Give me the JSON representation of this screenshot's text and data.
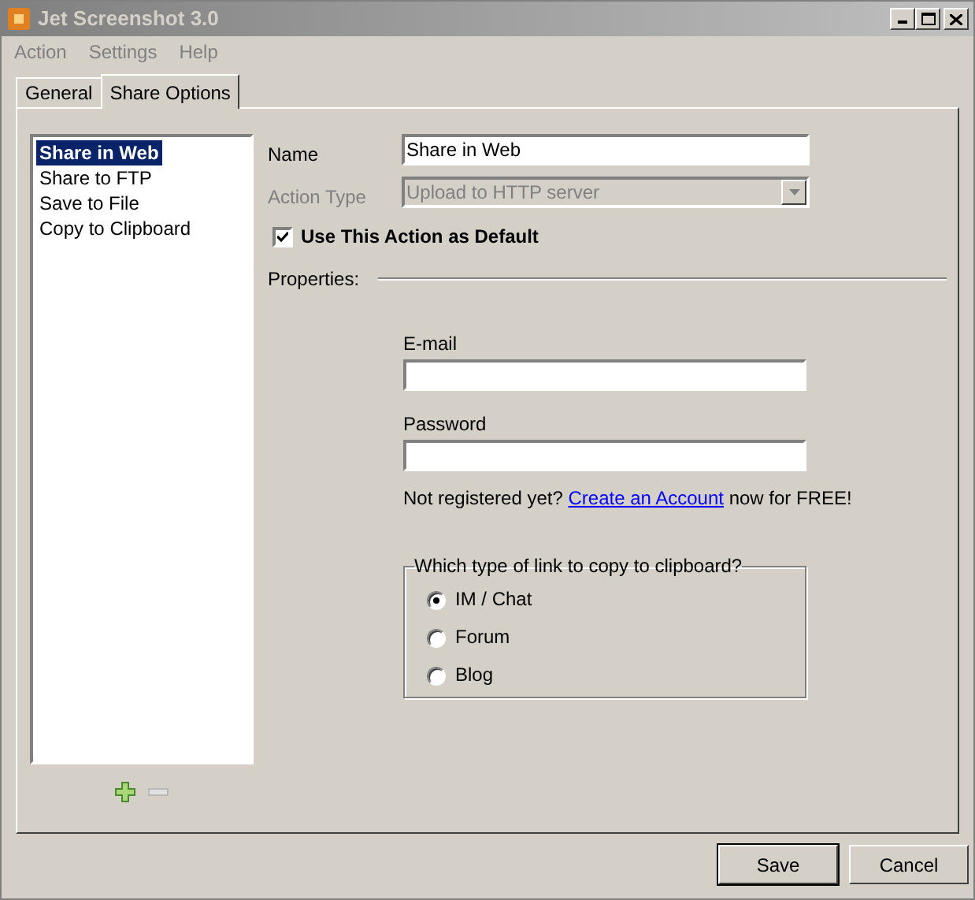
{
  "window": {
    "title": "Jet Screenshot 3.0"
  },
  "menu": [
    "Action",
    "Settings",
    "Help"
  ],
  "tabs": [
    {
      "label": "General",
      "selected": false
    },
    {
      "label": "Share Options",
      "selected": true
    }
  ],
  "actions": [
    {
      "label": "Share in Web",
      "selected": true
    },
    {
      "label": "Share to FTP",
      "selected": false
    },
    {
      "label": "Save to File",
      "selected": false
    },
    {
      "label": "Copy to Clipboard",
      "selected": false
    }
  ],
  "form": {
    "name_label": "Name",
    "name_value": "Share in Web",
    "action_type_label": "Action Type",
    "action_type_value": "Upload to HTTP server",
    "action_type_disabled": true,
    "default_checkbox": {
      "label": "Use This Action as Default",
      "checked": true
    },
    "properties_label": "Properties:",
    "email_label": "E-mail",
    "password_label": "Password",
    "register": {
      "before": "Not registered yet?",
      "link": "Create an Account",
      "after": "now for FREE!"
    },
    "link_type": {
      "legend": "Which type of link to copy to clipboard?",
      "options": [
        {
          "label": "IM / Chat",
          "selected": true
        },
        {
          "label": "Forum",
          "selected": false
        },
        {
          "label": "Blog",
          "selected": false
        }
      ]
    }
  },
  "buttons": [
    {
      "label": "Save",
      "default": true
    },
    {
      "label": "Cancel",
      "default": false
    }
  ]
}
